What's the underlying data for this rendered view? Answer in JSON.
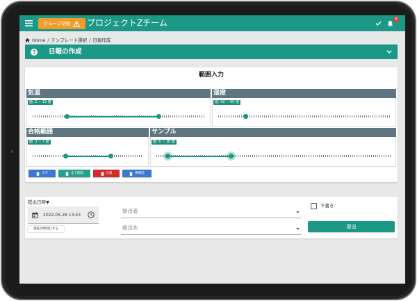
{
  "header": {
    "group_switch_label": "グループ切替",
    "title": "プロジェクトZチーム",
    "notification_count": "8",
    "icons": {
      "menu": "menu-icon",
      "warning": "warning-icon",
      "check": "check-icon",
      "bell": "bell-icon"
    }
  },
  "breadcrumb": {
    "separator": "/",
    "items": [
      "Home",
      "テンプレート選択",
      "日報作成"
    ]
  },
  "page_section": {
    "title": "日報の作成",
    "icons": {
      "help": "help-circle-icon",
      "toggle": "chevron-down-icon"
    }
  },
  "range_input": {
    "title": "範囲入力",
    "fields": [
      {
        "label": "気温",
        "value_badge": "値: 2 ~ 19 度",
        "slider_level_pct": [
          20,
          73
        ],
        "focused": false
      },
      {
        "label": "湿度",
        "value_badge": "値: 60 ~ 60 度",
        "slider_level_pct": [
          16,
          16
        ],
        "focused": false
      },
      {
        "label": "合格範囲",
        "value_badge": "値: 3 ~ 7 度",
        "slider_level_pct": [
          30,
          71
        ],
        "focused": false
      },
      {
        "label": "サンプル",
        "value_badge": "値: 6 ~ 36 度",
        "slider_level_pct": [
          5,
          32
        ],
        "focused": true
      }
    ],
    "actions": [
      {
        "label": "タグ",
        "icon": "trash-icon",
        "color": "#3c78d0"
      },
      {
        "label": "全て削除",
        "icon": "trash-icon",
        "color": "#26a08e"
      },
      {
        "label": "注意",
        "icon": "trash-icon",
        "color": "#d02c2c"
      },
      {
        "label": "要確認",
        "icon": "trash-icon",
        "color": "#3c78d0"
      }
    ]
  },
  "submission": {
    "datetime_label": "提出日時▼",
    "datetime_value": "2022-05-26 13:43",
    "set_now_label": "現在の時刻にする",
    "submitter_placeholder": "提出者",
    "destination_placeholder": "提出先",
    "draft_label": "下書き",
    "draft_checked": false,
    "submit_label": "提出",
    "icons": {
      "calendar": "calendar-icon",
      "clock": "clock-icon",
      "dropdown": "dropdown-arrow-icon"
    }
  },
  "colors": {
    "primary": "#1b9886",
    "group_switch": "#f29b2d",
    "field_header": "#5f7682",
    "notification": "#e53935",
    "value_badge": "#1f8f7e"
  }
}
